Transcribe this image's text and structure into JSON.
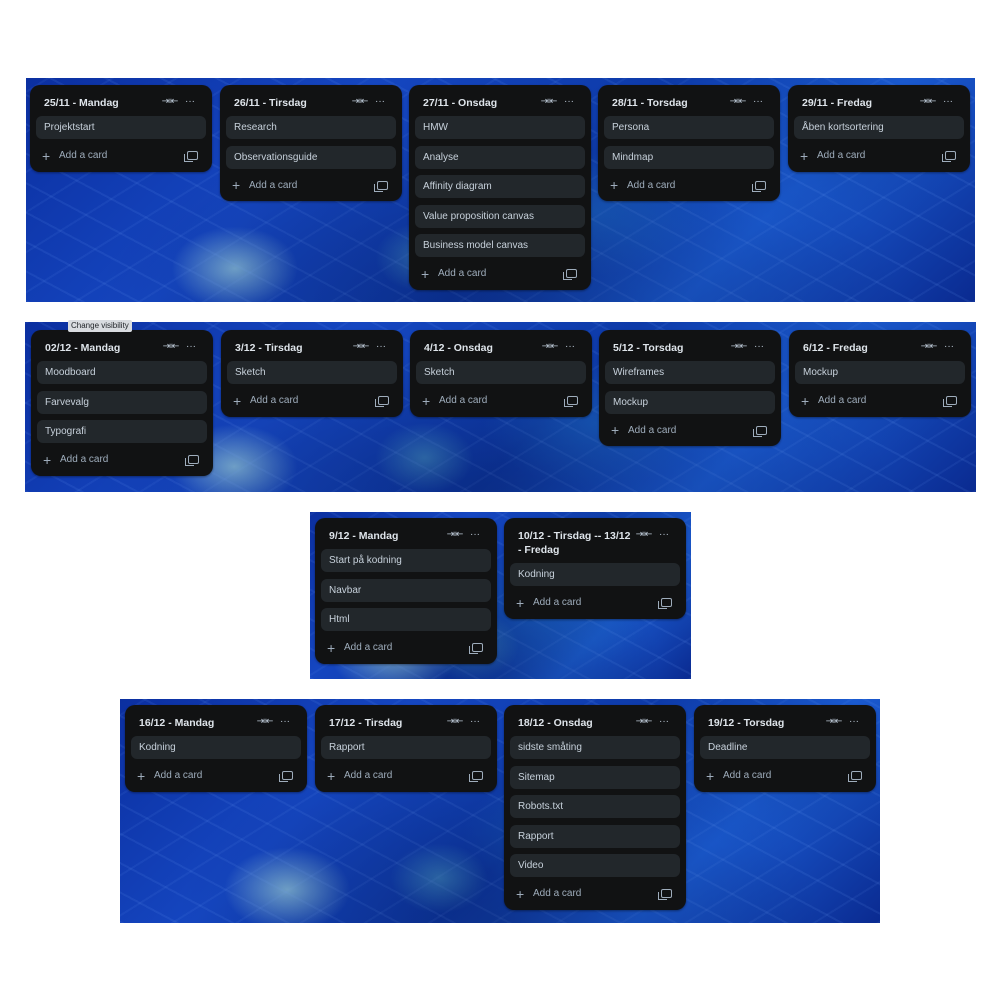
{
  "tooltip": "Change visibility",
  "header_icons": {
    "collapse": "⇥⇤",
    "more": "···"
  },
  "add_label": "Add a card",
  "boards": [
    {
      "lists": [
        {
          "title": "25/11 - Mandag",
          "cards": [
            "Projektstart"
          ]
        },
        {
          "title": "26/11 - Tirsdag",
          "cards": [
            "Research",
            "Observationsguide"
          ]
        },
        {
          "title": "27/11 - Onsdag",
          "cards": [
            "HMW",
            "Analyse",
            "Affinity diagram",
            "Value proposition canvas",
            "Business model canvas"
          ]
        },
        {
          "title": "28/11 - Torsdag",
          "cards": [
            "Persona",
            "Mindmap"
          ]
        },
        {
          "title": "29/11 - Fredag",
          "cards": [
            "Åben kortsortering"
          ]
        }
      ]
    },
    {
      "lists": [
        {
          "title": "02/12 - Mandag",
          "cards": [
            "Moodboard",
            "Farvevalg",
            "Typografi"
          ]
        },
        {
          "title": "3/12 - Tirsdag",
          "cards": [
            "Sketch"
          ]
        },
        {
          "title": "4/12 - Onsdag",
          "cards": [
            "Sketch"
          ]
        },
        {
          "title": "5/12 - Torsdag",
          "cards": [
            "Wireframes",
            "Mockup"
          ]
        },
        {
          "title": "6/12 - Fredag",
          "cards": [
            "Mockup"
          ]
        }
      ]
    },
    {
      "lists": [
        {
          "title": "9/12 - Mandag",
          "cards": [
            "Start på kodning",
            "Navbar",
            "Html"
          ]
        },
        {
          "title": "10/12 - Tirsdag -- 13/12 - Fredag",
          "cards": [
            "Kodning"
          ]
        }
      ]
    },
    {
      "lists": [
        {
          "title": "16/12 - Mandag",
          "cards": [
            "Kodning"
          ]
        },
        {
          "title": "17/12 - Tirsdag",
          "cards": [
            "Rapport"
          ]
        },
        {
          "title": "18/12 - Onsdag",
          "cards": [
            "sidste småting",
            "Sitemap",
            "Robots.txt",
            "Rapport",
            "Video"
          ]
        },
        {
          "title": "19/12 - Torsdag",
          "cards": [
            "Deadline"
          ]
        }
      ]
    }
  ]
}
